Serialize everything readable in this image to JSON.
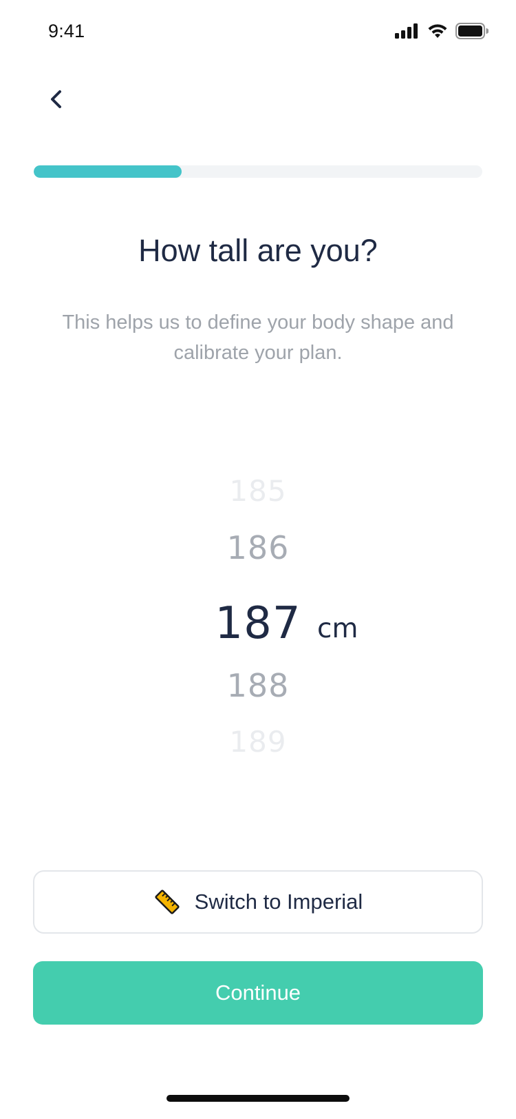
{
  "status_bar": {
    "time": "9:41",
    "icons": [
      "signal-icon",
      "wifi-icon",
      "battery-icon"
    ]
  },
  "navigation": {
    "back_icon": "chevron-left-icon"
  },
  "progress": {
    "fraction": 0.33,
    "color": "#44c4c9",
    "track_color": "#f2f4f6"
  },
  "header": {
    "title": "How tall are you?",
    "subtitle": "This helps us to define your body shape and calibrate your plan."
  },
  "picker": {
    "values": [
      "185",
      "186",
      "187",
      "188",
      "189"
    ],
    "selected": "187",
    "unit": "cm"
  },
  "actions": {
    "switch_label": "Switch to Imperial",
    "switch_icon": "ruler-icon",
    "continue_label": "Continue",
    "continue_color": "#44cdae"
  }
}
